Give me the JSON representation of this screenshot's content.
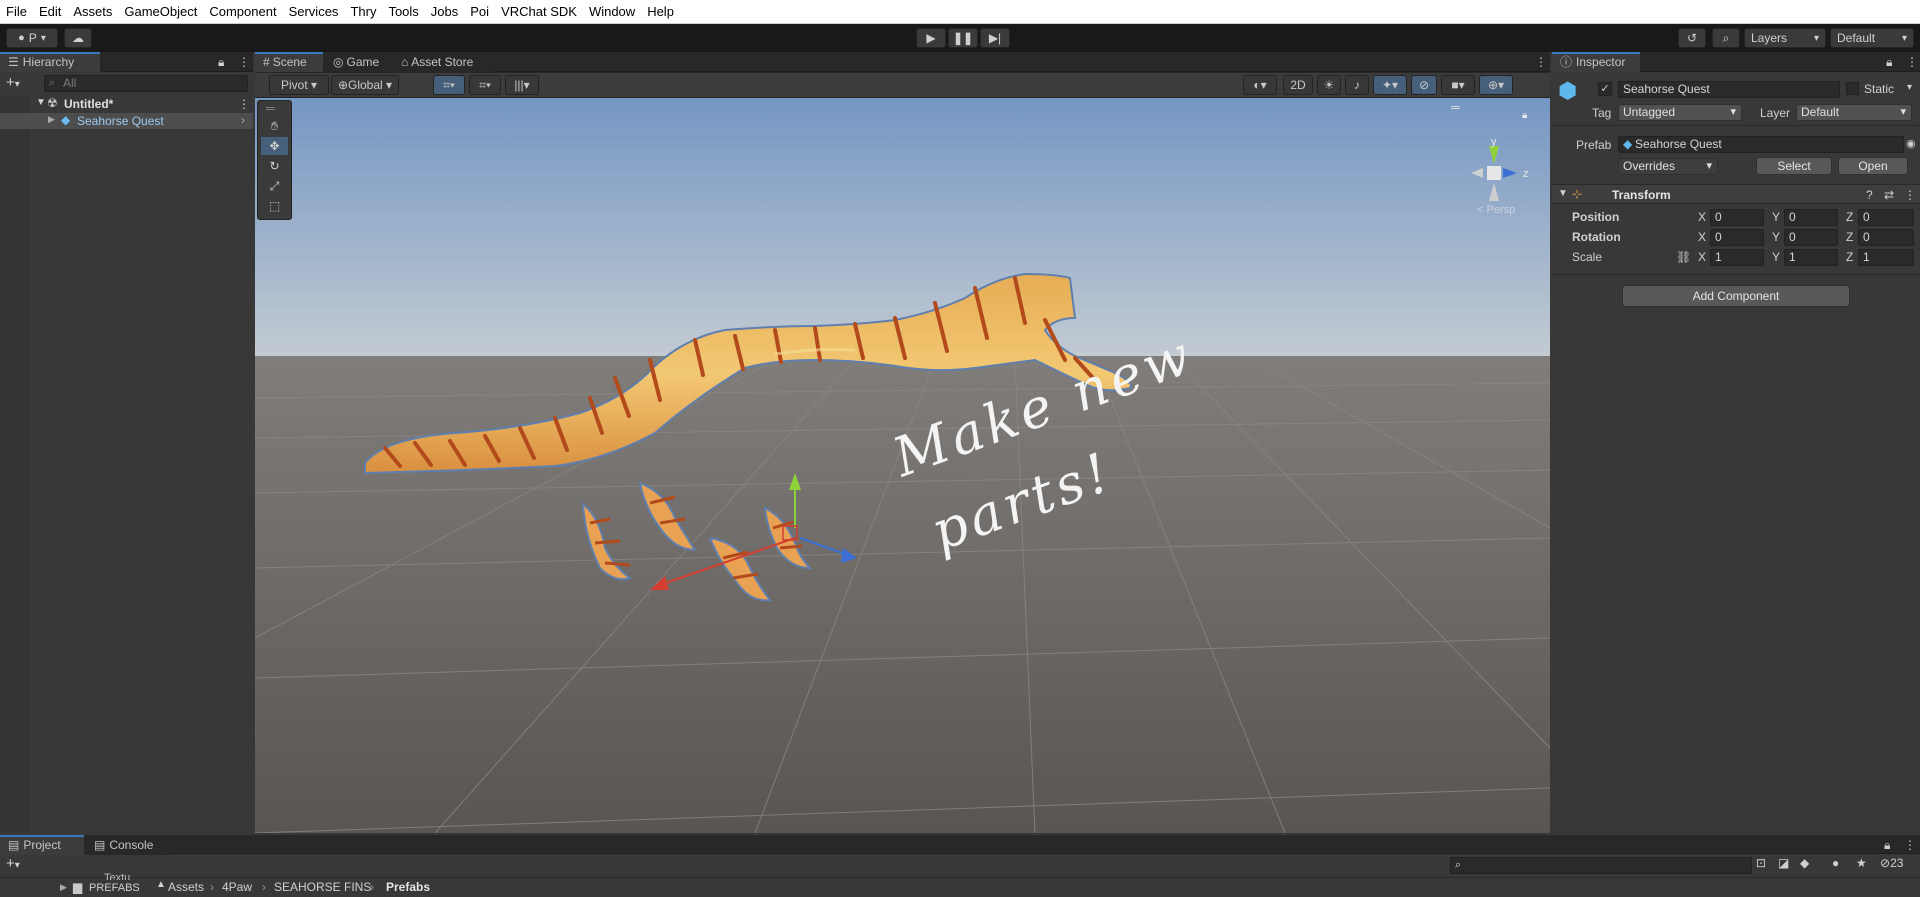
{
  "menu": [
    "File",
    "Edit",
    "Assets",
    "GameObject",
    "Component",
    "Services",
    "Thry",
    "Tools",
    "Jobs",
    "Poi",
    "VRChat SDK",
    "Window",
    "Help"
  ],
  "toolbar": {
    "account_label": "P",
    "layers_label": "Layers",
    "layout_label": "Default"
  },
  "hierarchy": {
    "tab": "Hierarchy",
    "search_placeholder": "All",
    "scene_name": "Untitled*",
    "items": [
      {
        "label": "Seahorse Quest"
      }
    ]
  },
  "scene": {
    "tabs": [
      "Scene",
      "Game",
      "Asset Store"
    ],
    "pivot_label": "Pivot",
    "global_label": "Global",
    "mode_2d": "2D",
    "gizmo_persp": "< Persp",
    "gizmo_y": "y",
    "gizmo_z": "z",
    "annotation_line1": "Make new",
    "annotation_line2": "parts!"
  },
  "inspector": {
    "tab": "Inspector",
    "object_name": "Seahorse Quest",
    "static_label": "Static",
    "tag_label": "Tag",
    "tag_value": "Untagged",
    "layer_label": "Layer",
    "layer_value": "Default",
    "prefab_label": "Prefab",
    "prefab_value": "Seahorse Quest",
    "overrides_label": "Overrides",
    "select_label": "Select",
    "open_label": "Open",
    "transform_label": "Transform",
    "rows": [
      {
        "label": "Position",
        "x": "0",
        "y": "0",
        "z": "0"
      },
      {
        "label": "Rotation",
        "x": "0",
        "y": "0",
        "z": "0"
      },
      {
        "label": "Scale",
        "x": "1",
        "y": "1",
        "z": "1"
      }
    ],
    "axis_x": "X",
    "axis_y": "Y",
    "axis_z": "Z",
    "add_component": "Add Component"
  },
  "project": {
    "tabs": [
      "Project",
      "Console"
    ],
    "tree_items": [
      "Textu",
      "PREFABS"
    ],
    "breadcrumb": [
      "Assets",
      "4Paw",
      "SEAHORSE FINS",
      "Prefabs"
    ],
    "hidden_count": "23"
  },
  "colors": {
    "accent": "#3a79bb",
    "selection": "#2c5d87",
    "sky_top": "#7c9ac0",
    "ground": "#5f5b58"
  }
}
